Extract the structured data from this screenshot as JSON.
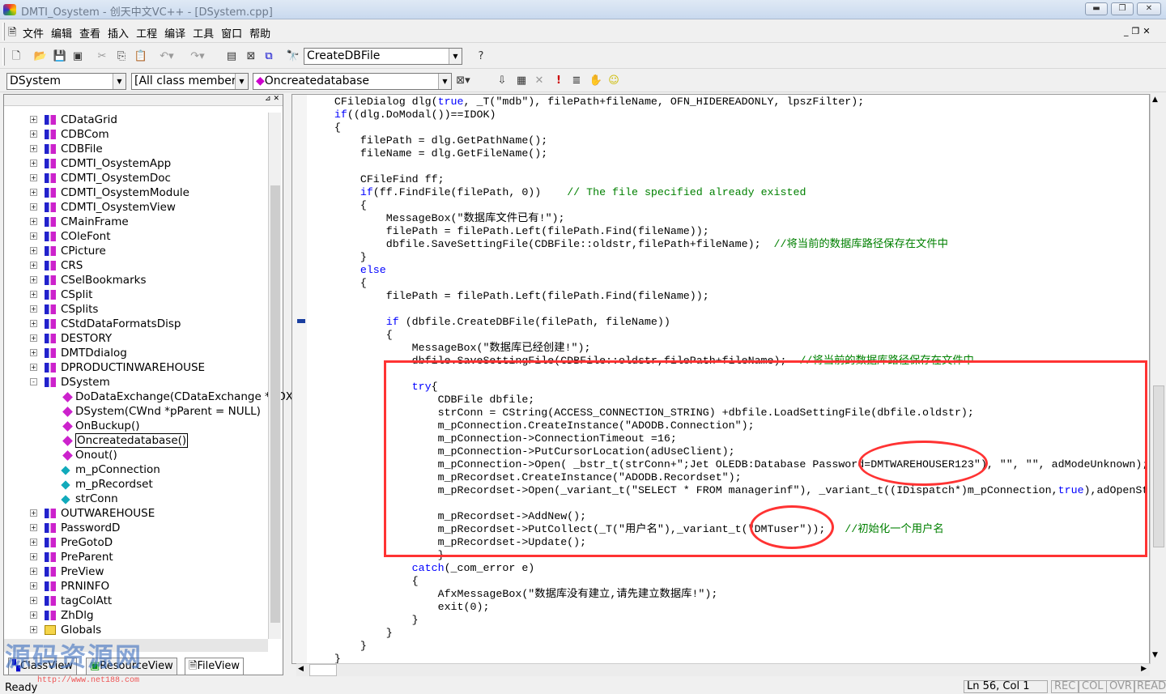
{
  "window": {
    "title": "DMTI_Osystem - 创天中文VC++ - [DSystem.cpp]"
  },
  "menu": [
    "文件",
    "编辑",
    "查看",
    "插入",
    "工程",
    "编译",
    "工具",
    "窗口",
    "帮助"
  ],
  "toolbar": {
    "find_combo": "CreateDBFile"
  },
  "wizardbar": {
    "class_combo": "DSystem",
    "filter_combo": "[All class members]",
    "member_combo": "Oncreatedatabase"
  },
  "classview": {
    "items": [
      {
        "label": "CDataGrid",
        "type": "class",
        "level": 0,
        "expander": "+"
      },
      {
        "label": "CDBCom",
        "type": "class",
        "level": 0,
        "expander": "+"
      },
      {
        "label": "CDBFile",
        "type": "class",
        "level": 0,
        "expander": "+"
      },
      {
        "label": "CDMTI_OsystemApp",
        "type": "class",
        "level": 0,
        "expander": "+"
      },
      {
        "label": "CDMTI_OsystemDoc",
        "type": "class",
        "level": 0,
        "expander": "+"
      },
      {
        "label": "CDMTI_OsystemModule",
        "type": "class",
        "level": 0,
        "expander": "+"
      },
      {
        "label": "CDMTI_OsystemView",
        "type": "class",
        "level": 0,
        "expander": "+"
      },
      {
        "label": "CMainFrame",
        "type": "class",
        "level": 0,
        "expander": "+"
      },
      {
        "label": "COleFont",
        "type": "class",
        "level": 0,
        "expander": "+"
      },
      {
        "label": "CPicture",
        "type": "class",
        "level": 0,
        "expander": "+"
      },
      {
        "label": "CRS",
        "type": "class",
        "level": 0,
        "expander": "+"
      },
      {
        "label": "CSelBookmarks",
        "type": "class",
        "level": 0,
        "expander": "+"
      },
      {
        "label": "CSplit",
        "type": "class",
        "level": 0,
        "expander": "+"
      },
      {
        "label": "CSplits",
        "type": "class",
        "level": 0,
        "expander": "+"
      },
      {
        "label": "CStdDataFormatsDisp",
        "type": "class",
        "level": 0,
        "expander": "+"
      },
      {
        "label": "DESTORY",
        "type": "class",
        "level": 0,
        "expander": "+"
      },
      {
        "label": "DMTDdialog",
        "type": "class",
        "level": 0,
        "expander": "+"
      },
      {
        "label": "DPRODUCTINWAREHOUSE",
        "type": "class",
        "level": 0,
        "expander": "+"
      },
      {
        "label": "DSystem",
        "type": "class",
        "level": 0,
        "expander": "-"
      },
      {
        "label": "DoDataExchange(CDataExchange *pDX)",
        "type": "method-protected",
        "level": 1
      },
      {
        "label": "DSystem(CWnd *pParent = NULL)",
        "type": "method",
        "level": 1
      },
      {
        "label": "OnBuckup()",
        "type": "method-protected",
        "level": 1
      },
      {
        "label": "Oncreatedatabase()",
        "type": "method-protected",
        "level": 1,
        "selected": true
      },
      {
        "label": "Onout()",
        "type": "method-protected",
        "level": 1
      },
      {
        "label": "m_pConnection",
        "type": "member",
        "level": 1
      },
      {
        "label": "m_pRecordset",
        "type": "member",
        "level": 1
      },
      {
        "label": "strConn",
        "type": "member",
        "level": 1
      },
      {
        "label": "OUTWAREHOUSE",
        "type": "class",
        "level": 0,
        "expander": "+"
      },
      {
        "label": "PasswordD",
        "type": "class",
        "level": 0,
        "expander": "+"
      },
      {
        "label": "PreGotoD",
        "type": "class",
        "level": 0,
        "expander": "+"
      },
      {
        "label": "PreParent",
        "type": "class",
        "level": 0,
        "expander": "+"
      },
      {
        "label": "PreView",
        "type": "class",
        "level": 0,
        "expander": "+"
      },
      {
        "label": "PRNINFO",
        "type": "class",
        "level": 0,
        "expander": "+"
      },
      {
        "label": "tagColAtt",
        "type": "class",
        "level": 0,
        "expander": "+"
      },
      {
        "label": "ZhDlg",
        "type": "class",
        "level": 0,
        "expander": "+"
      },
      {
        "label": "Globals",
        "type": "folder",
        "level": 0,
        "expander": "+"
      }
    ]
  },
  "tabs": [
    "ClassView",
    "ResourceView",
    "FileView"
  ],
  "watermark": {
    "text": "源码资源网",
    "url": "http://www.net188.com"
  },
  "code": [
    [
      [
        "n",
        "    CFileDialog dlg("
      ],
      [
        "k",
        "true"
      ],
      [
        "n",
        ", _T(\"mdb\"), filePath+fileName, OFN_HIDEREADONLY, lpszFilter);"
      ]
    ],
    [
      [
        "k",
        "    if"
      ],
      [
        "n",
        "((dlg.DoModal())==IDOK)"
      ]
    ],
    [
      [
        "n",
        "    {"
      ]
    ],
    [
      [
        "n",
        "        filePath = dlg.GetPathName();"
      ]
    ],
    [
      [
        "n",
        "        fileName = dlg.GetFileName();"
      ]
    ],
    [],
    [
      [
        "n",
        "        CFileFind ff;"
      ]
    ],
    [
      [
        "k",
        "        if"
      ],
      [
        "n",
        "(ff.FindFile(filePath, 0))    "
      ],
      [
        "c",
        "// The file specified already existed"
      ]
    ],
    [
      [
        "n",
        "        {"
      ]
    ],
    [
      [
        "n",
        "            MessageBox(\"数据库文件已有!\");"
      ]
    ],
    [
      [
        "n",
        "            filePath = filePath.Left(filePath.Find(fileName));"
      ]
    ],
    [
      [
        "n",
        "            dbfile.SaveSettingFile(CDBFile::oldstr,filePath+fileName);  "
      ],
      [
        "c",
        "//将当前的数据库路径保存在文件中"
      ]
    ],
    [
      [
        "n",
        "        }"
      ]
    ],
    [
      [
        "k",
        "        else"
      ]
    ],
    [
      [
        "n",
        "        {"
      ]
    ],
    [
      [
        "n",
        "            filePath = filePath.Left(filePath.Find(fileName));"
      ]
    ],
    [],
    [
      [
        "k",
        "            if"
      ],
      [
        "n",
        " (dbfile.CreateDBFile(filePath, fileName))"
      ]
    ],
    [
      [
        "n",
        "            {"
      ]
    ],
    [
      [
        "n",
        "                MessageBox(\"数据库已经创建!\");"
      ]
    ],
    [
      [
        "n",
        "                dbfile.SaveSettingFile(CDBFile::oldstr,filePath+fileName);  "
      ],
      [
        "c",
        "//将当前的数据库路径保存在文件中"
      ]
    ],
    [],
    [
      [
        "k",
        "                try"
      ],
      [
        "n",
        "{"
      ]
    ],
    [
      [
        "n",
        "                    CDBFile dbfile;"
      ]
    ],
    [
      [
        "n",
        "                    strConn = CString(ACCESS_CONNECTION_STRING) +dbfile.LoadSettingFile(dbfile.oldstr);"
      ]
    ],
    [
      [
        "n",
        "                    m_pConnection.CreateInstance(\"ADODB.Connection\");"
      ]
    ],
    [
      [
        "n",
        "                    m_pConnection->ConnectionTimeout =16;"
      ]
    ],
    [
      [
        "n",
        "                    m_pConnection->PutCursorLocation(adUseClient);"
      ]
    ],
    [
      [
        "n",
        "                    m_pConnection->Open( _bstr_t(strConn+\";Jet OLEDB:Database Password=DMTWAREHOUSER123\"), \"\", \"\", adModeUnknown);"
      ]
    ],
    [
      [
        "n",
        "                    m_pRecordset.CreateInstance(\"ADODB.Recordset\");"
      ]
    ],
    [
      [
        "n",
        "                    m_pRecordset->Open(_variant_t(\"SELECT * FROM managerinf\"), _variant_t((IDispatch*)m_pConnection,"
      ],
      [
        "k",
        "true"
      ],
      [
        "n",
        "),adOpenStatic"
      ]
    ],
    [],
    [
      [
        "n",
        "                    m_pRecordset->AddNew();"
      ]
    ],
    [
      [
        "n",
        "                    m_pRecordset->PutCollect(_T(\"用户名\"),_variant_t(\"DMTuser\"));   "
      ],
      [
        "c",
        "//初始化一个用户名"
      ]
    ],
    [
      [
        "n",
        "                    m_pRecordset->Update();"
      ]
    ],
    [
      [
        "n",
        "                    }"
      ]
    ],
    [
      [
        "k",
        "                catch"
      ],
      [
        "n",
        "(_com_error e)"
      ]
    ],
    [
      [
        "n",
        "                {"
      ]
    ],
    [
      [
        "n",
        "                    AfxMessageBox(\"数据库没有建立,请先建立数据库!\");"
      ]
    ],
    [
      [
        "n",
        "                    exit(0);"
      ]
    ],
    [
      [
        "n",
        "                }"
      ]
    ],
    [
      [
        "n",
        "            }"
      ]
    ],
    [
      [
        "n",
        "        }"
      ]
    ],
    [
      [
        "n",
        "    }"
      ]
    ]
  ],
  "status": {
    "text": "Ready",
    "position": "Ln 56, Col 1",
    "indicators": [
      "REC",
      "COL",
      "OVR",
      "READ"
    ]
  },
  "colors": {
    "keyword": "#0000ff",
    "comment": "#008000",
    "annotation": "#ff3333"
  }
}
